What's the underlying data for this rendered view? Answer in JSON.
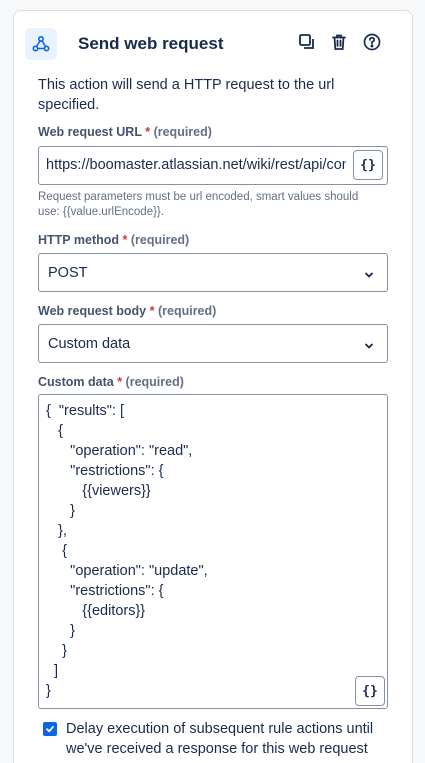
{
  "header": {
    "title": "Send web request",
    "icon": "webhook-icon",
    "actions": [
      "duplicate-icon",
      "trash-icon",
      "help-icon"
    ]
  },
  "description": "This action will send a HTTP request to the url specified.",
  "url_field": {
    "label": "Web request URL",
    "star": "*",
    "required_text": "(required)",
    "value": "https://boomaster.atlassian.net/wiki/rest/api/content",
    "smart_value_button": "{}",
    "helper": "Request parameters must be url encoded, smart values should use: {{value.urlEncode}}."
  },
  "method_field": {
    "label": "HTTP method",
    "star": "*",
    "required_text": "(required)",
    "value": "POST"
  },
  "body_field": {
    "label": "Web request body",
    "star": "*",
    "required_text": "(required)",
    "value": "Custom data"
  },
  "custom_data_field": {
    "label": "Custom data",
    "star": "*",
    "required_text": "(required)",
    "value": "{  \"results\": [\n   {\n      \"operation\": \"read\",\n      \"restrictions\": {\n         {{viewers}}\n      }\n   },\n    {\n      \"operation\": \"update\",\n      \"restrictions\": {\n         {{editors}}\n      }\n    }\n  ]\n}",
    "smart_value_button": "{}"
  },
  "delay_checkbox": {
    "checked": true,
    "label": "Delay execution of subsequent rule actions until we've received a response for this web request"
  },
  "colors": {
    "accent": "#0c66e4",
    "required": "#c9372c",
    "icon_bg": "#e9f2ff"
  }
}
